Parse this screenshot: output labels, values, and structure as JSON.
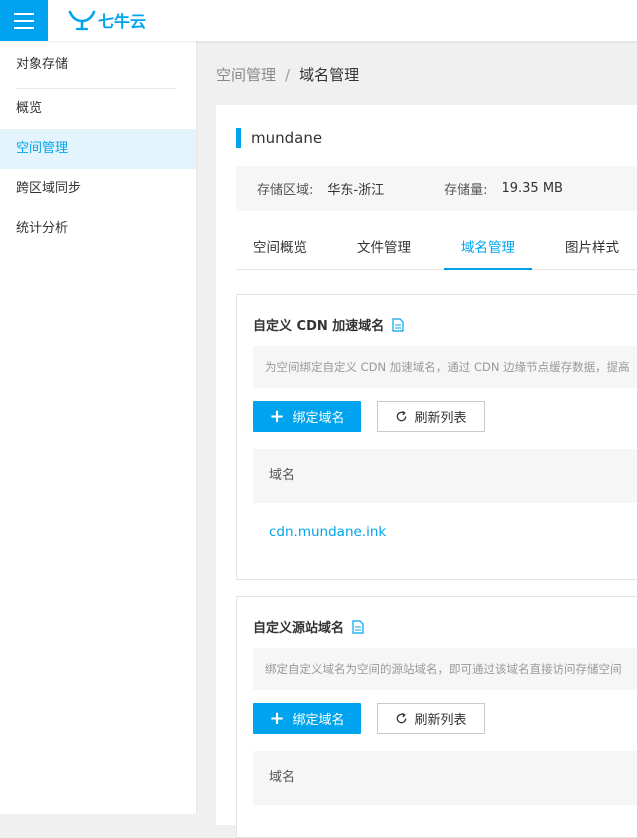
{
  "brand": {
    "logo_text": "七牛云"
  },
  "sidebar": {
    "items": [
      {
        "label": "对象存储"
      },
      {
        "label": "概览"
      },
      {
        "label": "空间管理"
      },
      {
        "label": "跨区域同步"
      },
      {
        "label": "统计分析"
      }
    ]
  },
  "breadcrumb": {
    "parent": "空间管理",
    "separator": "/",
    "current": "域名管理"
  },
  "bucket": {
    "name": "mundane",
    "region_label": "存储区域:",
    "region_value": "华东-浙江",
    "storage_label": "存储量:",
    "storage_value": "19.35 MB"
  },
  "tabs": [
    {
      "label": "空间概览"
    },
    {
      "label": "文件管理"
    },
    {
      "label": "域名管理"
    },
    {
      "label": "图片样式"
    }
  ],
  "cdn_section": {
    "title": "自定义 CDN 加速域名",
    "description": "为空间绑定自定义 CDN 加速域名，通过 CDN 边缘节点缓存数据，提高",
    "bind_button": "绑定域名",
    "refresh_button": "刷新列表",
    "column_header": "域名",
    "domains": [
      "cdn.mundane.ink"
    ]
  },
  "origin_section": {
    "title": "自定义源站域名",
    "description": "绑定自定义域名为空间的源站域名，即可通过该域名直接访问存储空间",
    "bind_button": "绑定域名",
    "refresh_button": "刷新列表",
    "column_header": "域名"
  },
  "colors": {
    "accent": "#00a4ee",
    "active_bg": "#e3f4fc"
  }
}
